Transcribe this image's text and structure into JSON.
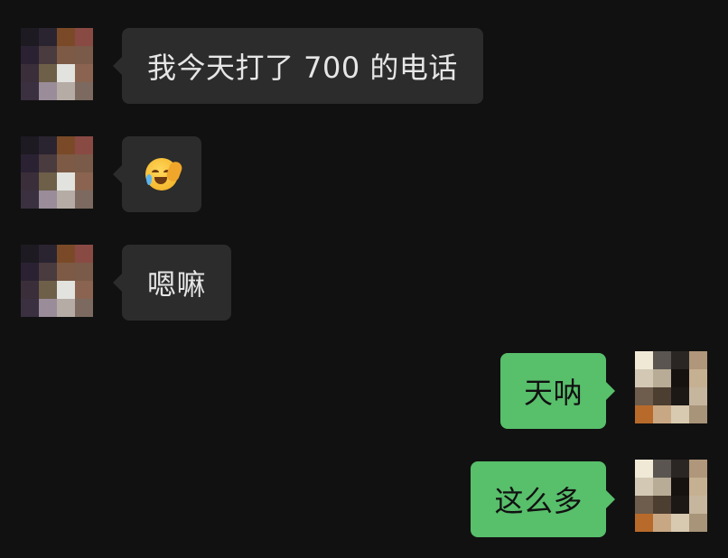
{
  "messages": [
    {
      "side": "in",
      "type": "text",
      "text": "我今天打了 700 的电话"
    },
    {
      "side": "in",
      "type": "emoji",
      "emoji_name": "crying-facepalm-emoji"
    },
    {
      "side": "in",
      "type": "text",
      "text": "嗯嘛"
    },
    {
      "side": "out",
      "type": "text",
      "text": "天呐"
    },
    {
      "side": "out",
      "type": "text",
      "text": "这么多"
    }
  ],
  "colors": {
    "background": "#111111",
    "incoming_bubble": "#2c2c2c",
    "outgoing_bubble": "#58bf6b",
    "incoming_text": "#e6e6e6",
    "outgoing_text": "#111111"
  },
  "avatars": {
    "contact": [
      "#1d1a22",
      "#2a2430",
      "#7a4a28",
      "#8a4a44",
      "#2a2233",
      "#4a3b3e",
      "#7d5a45",
      "#7a5a48",
      "#3a2e3a",
      "#6e6048",
      "#e2e2de",
      "#8a6450",
      "#3a3040",
      "#9a8c98",
      "#b6aca6",
      "#7c6a60"
    ],
    "self": [
      "#efe9d6",
      "#5a5550",
      "#2a2624",
      "#b0967a",
      "#d2c8b4",
      "#b8ac96",
      "#161210",
      "#c6b092",
      "#6e5c4c",
      "#4c3e30",
      "#1c1816",
      "#c6b69e",
      "#b86a2a",
      "#c8a884",
      "#d8cab0",
      "#a89478"
    ]
  }
}
